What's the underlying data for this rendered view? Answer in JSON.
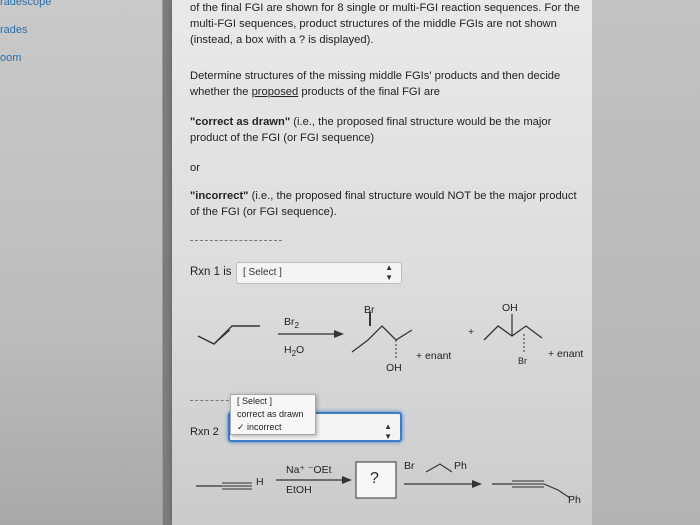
{
  "sidebar": {
    "items": [
      "radescope",
      "rades",
      "oom"
    ]
  },
  "question": {
    "intro": "of the final FGI are shown for 8 single or multi-FGI reaction sequences. For the multi-FGI sequences, product structures of the middle FGIs are not shown (instead, a box with a ? is displayed).",
    "instruction_start": "Determine structures of the missing middle FGIs' products and then decide whether the ",
    "instruction_link": "proposed",
    "instruction_end": " products of the final FGI are",
    "correct_label": "\"correct as drawn\"",
    "correct_text": " (i.e., the proposed final structure would be the major product of the FGI (or FGI sequence)",
    "or_text": "or",
    "incorrect_label": "\"incorrect\"",
    "incorrect_text": " (i.e., the proposed final structure would NOT be the major product of the FGI (or FGI sequence)."
  },
  "rxn1": {
    "label": "Rxn 1 is",
    "select_value": "[ Select ]",
    "reagent_top": "Br",
    "reagent_sub": "2",
    "reagent_bottom_main": "H",
    "reagent_bottom_sub": "2",
    "reagent_bottom_end": "O",
    "product1_top": "Br",
    "product1_bottom": "OH",
    "enant1": "+ enant",
    "plus": "+",
    "product2_top": "OH",
    "product2_bottom": "Br",
    "enant2": "+ enant"
  },
  "rxn2": {
    "label": "Rxn 2",
    "options": [
      "[ Select ]",
      "correct as drawn",
      "incorrect"
    ],
    "checked_option": "incorrect",
    "reagent_top": "Na⁺ ⁻OEt",
    "reagent_bottom": "EtOH",
    "h_label": "H",
    "box_label": "?",
    "br_label": "Br",
    "ph_label_top": "Ph",
    "ph_label_product": "Ph"
  }
}
